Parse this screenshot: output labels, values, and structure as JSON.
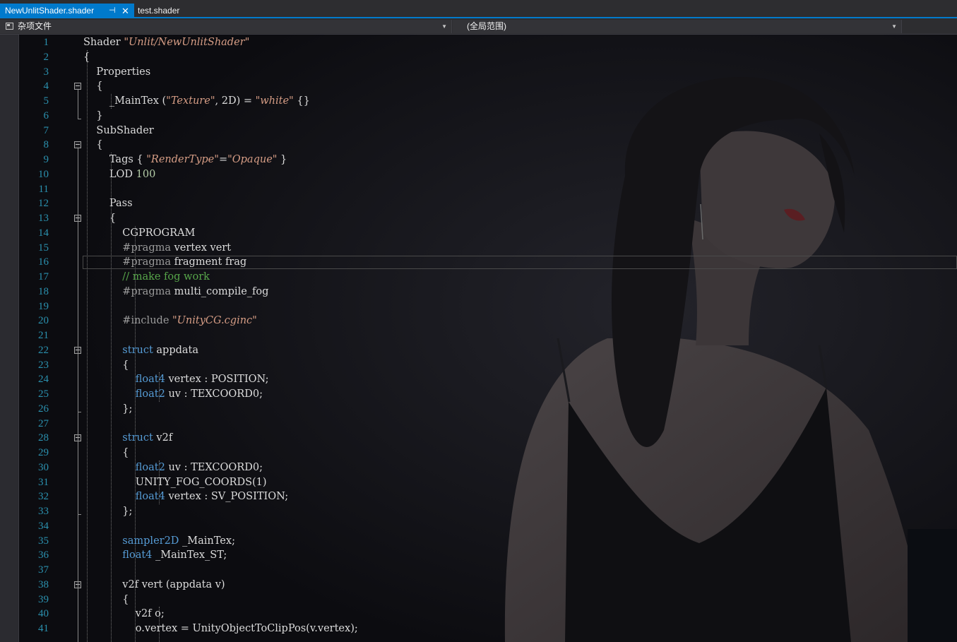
{
  "tabs": [
    {
      "label": "NewUnlitShader.shader",
      "pin_icon": "pin-icon",
      "close_icon": "close-icon"
    },
    {
      "label": "test.shader"
    }
  ],
  "nav": {
    "scope_left": "杂项文件",
    "scope_right": "(全局范围)",
    "dropdown_icon": "chevron-down-icon"
  },
  "colors": {
    "accent": "#007acc",
    "line_number": "#2b91af",
    "keyword": "#569cd6",
    "string": "#d69d85",
    "comment": "#57a64a",
    "number": "#b5cea8",
    "text": "#dcdcdc"
  },
  "editor": {
    "current_line": 16,
    "lines": [
      {
        "n": "1",
        "tokens": [
          [
            "plain",
            "Shader "
          ],
          [
            "str",
            "\"Unlit/NewUnlitShader\""
          ]
        ]
      },
      {
        "n": "2",
        "tokens": [
          [
            "plain",
            "{"
          ]
        ]
      },
      {
        "n": "3",
        "tokens": [
          [
            "plain",
            "    Properties"
          ]
        ]
      },
      {
        "n": "4",
        "tokens": [
          [
            "plain",
            "    {"
          ]
        ]
      },
      {
        "n": "5",
        "tokens": [
          [
            "plain",
            "        _MainTex ("
          ],
          [
            "str",
            "\"Texture\""
          ],
          [
            "plain",
            ", 2D) = "
          ],
          [
            "str",
            "\"white\""
          ],
          [
            "plain",
            " {}"
          ]
        ]
      },
      {
        "n": "6",
        "tokens": [
          [
            "plain",
            "    }"
          ]
        ]
      },
      {
        "n": "7",
        "tokens": [
          [
            "plain",
            "    SubShader"
          ]
        ]
      },
      {
        "n": "8",
        "tokens": [
          [
            "plain",
            "    {"
          ]
        ]
      },
      {
        "n": "9",
        "tokens": [
          [
            "plain",
            "        Tags { "
          ],
          [
            "str",
            "\"RenderType\""
          ],
          [
            "plain",
            "="
          ],
          [
            "str",
            "\"Opaque\""
          ],
          [
            "plain",
            " }"
          ]
        ]
      },
      {
        "n": "10",
        "tokens": [
          [
            "plain",
            "        LOD "
          ],
          [
            "num",
            "100"
          ]
        ]
      },
      {
        "n": "11",
        "tokens": []
      },
      {
        "n": "12",
        "tokens": [
          [
            "plain",
            "        Pass"
          ]
        ]
      },
      {
        "n": "13",
        "tokens": [
          [
            "plain",
            "        {"
          ]
        ]
      },
      {
        "n": "14",
        "tokens": [
          [
            "plain",
            "            CGPROGRAM"
          ]
        ]
      },
      {
        "n": "15",
        "tokens": [
          [
            "pp",
            "            #pragma"
          ],
          [
            "plain",
            " vertex vert"
          ]
        ]
      },
      {
        "n": "16",
        "tokens": [
          [
            "pp",
            "            #pragma"
          ],
          [
            "plain",
            " fragment frag"
          ]
        ]
      },
      {
        "n": "17",
        "tokens": [
          [
            "cmt",
            "            // make fog work"
          ]
        ]
      },
      {
        "n": "18",
        "tokens": [
          [
            "pp",
            "            #pragma"
          ],
          [
            "plain",
            " multi_compile_fog"
          ]
        ]
      },
      {
        "n": "19",
        "tokens": []
      },
      {
        "n": "20",
        "tokens": [
          [
            "pp",
            "            #include"
          ],
          [
            "plain",
            " "
          ],
          [
            "str",
            "\"UnityCG.cginc\""
          ]
        ]
      },
      {
        "n": "21",
        "tokens": []
      },
      {
        "n": "22",
        "tokens": [
          [
            "kw",
            "            struct"
          ],
          [
            "plain",
            " appdata"
          ]
        ]
      },
      {
        "n": "23",
        "tokens": [
          [
            "plain",
            "            {"
          ]
        ]
      },
      {
        "n": "24",
        "tokens": [
          [
            "kw",
            "                float4"
          ],
          [
            "plain",
            " vertex : POSITION;"
          ]
        ]
      },
      {
        "n": "25",
        "tokens": [
          [
            "kw",
            "                float2"
          ],
          [
            "plain",
            " uv : TEXCOORD0;"
          ]
        ]
      },
      {
        "n": "26",
        "tokens": [
          [
            "plain",
            "            };"
          ]
        ]
      },
      {
        "n": "27",
        "tokens": []
      },
      {
        "n": "28",
        "tokens": [
          [
            "kw",
            "            struct"
          ],
          [
            "plain",
            " v2f"
          ]
        ]
      },
      {
        "n": "29",
        "tokens": [
          [
            "plain",
            "            {"
          ]
        ]
      },
      {
        "n": "30",
        "tokens": [
          [
            "kw",
            "                float2"
          ],
          [
            "plain",
            " uv : TEXCOORD0;"
          ]
        ]
      },
      {
        "n": "31",
        "tokens": [
          [
            "plain",
            "                UNITY_FOG_COORDS(1)"
          ]
        ]
      },
      {
        "n": "32",
        "tokens": [
          [
            "kw",
            "                float4"
          ],
          [
            "plain",
            " vertex : SV_POSITION;"
          ]
        ]
      },
      {
        "n": "33",
        "tokens": [
          [
            "plain",
            "            };"
          ]
        ]
      },
      {
        "n": "34",
        "tokens": []
      },
      {
        "n": "35",
        "tokens": [
          [
            "kw",
            "            sampler2D"
          ],
          [
            "plain",
            " _MainTex;"
          ]
        ]
      },
      {
        "n": "36",
        "tokens": [
          [
            "kw",
            "            float4"
          ],
          [
            "plain",
            " _MainTex_ST;"
          ]
        ]
      },
      {
        "n": "37",
        "tokens": []
      },
      {
        "n": "38",
        "tokens": [
          [
            "plain",
            "            v2f vert (appdata v)"
          ]
        ]
      },
      {
        "n": "39",
        "tokens": [
          [
            "plain",
            "            {"
          ]
        ]
      },
      {
        "n": "40",
        "tokens": [
          [
            "plain",
            "                v2f o;"
          ]
        ]
      },
      {
        "n": "41",
        "tokens": [
          [
            "plain",
            "                o.vertex = UnityObjectToClipPos(v.vertex);"
          ]
        ]
      }
    ]
  }
}
